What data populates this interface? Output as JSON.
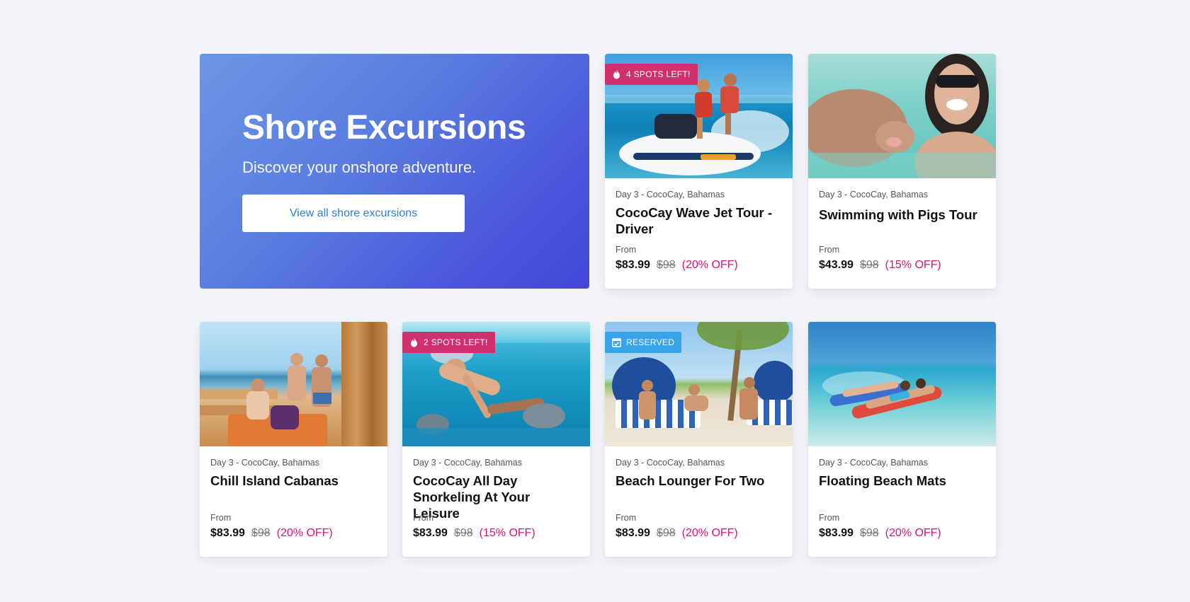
{
  "hero": {
    "title": "Shore Excursions",
    "subtitle": "Discover your onshore adventure.",
    "button_label": "View all shore excursions"
  },
  "colors": {
    "hero_gradient_start": "#6b97e6",
    "hero_gradient_end": "#4446d7",
    "discount": "#d3176f",
    "hot_badge": "#d0306d",
    "reserved_badge": "#38a5ea",
    "link": "#2f7fd0"
  },
  "cards": [
    {
      "location": "Day 3 - CocoCay, Bahamas",
      "title": "CocoCay Wave Jet Tour - Driver",
      "from_label": "From",
      "price": "$83.99",
      "original_price": "$98",
      "discount": "(20% OFF)",
      "badge": {
        "type": "hot",
        "icon": "flame-icon",
        "label": "4 SPOTS LEFT!"
      },
      "image": "jet-ski"
    },
    {
      "location": "Day 3 - CocoCay, Bahamas",
      "title": "Swimming with Pigs Tour",
      "from_label": "From",
      "price": "$43.99",
      "original_price": "$98",
      "discount": "(15% OFF)",
      "badge": null,
      "image": "swimming-pig"
    },
    {
      "location": "Day 3 - CocoCay, Bahamas",
      "title": "Chill Island Cabanas",
      "from_label": "From",
      "price": "$83.99",
      "original_price": "$98",
      "discount": "(20% OFF)",
      "badge": null,
      "image": "cabana-deck"
    },
    {
      "location": "Day 3 - CocoCay, Bahamas",
      "title": "CocoCay All Day Snorkeling At Your Leisure",
      "from_label": "From",
      "price": "$83.99",
      "original_price": "$98",
      "discount": "(15% OFF)",
      "badge": {
        "type": "hot",
        "icon": "flame-icon",
        "label": "2 SPOTS LEFT!"
      },
      "image": "snorkeling"
    },
    {
      "location": "Day 3 - CocoCay, Bahamas",
      "title": "Beach Lounger For Two",
      "from_label": "From",
      "price": "$83.99",
      "original_price": "$98",
      "discount": "(20% OFF)",
      "badge": {
        "type": "reserved",
        "icon": "calendar-check-icon",
        "label": "RESERVED"
      },
      "image": "beach-loungers"
    },
    {
      "location": "Day 3 - CocoCay, Bahamas",
      "title": "Floating Beach Mats",
      "from_label": "From",
      "price": "$83.99",
      "original_price": "$98",
      "discount": "(20% OFF)",
      "badge": null,
      "image": "floating-mats"
    }
  ]
}
